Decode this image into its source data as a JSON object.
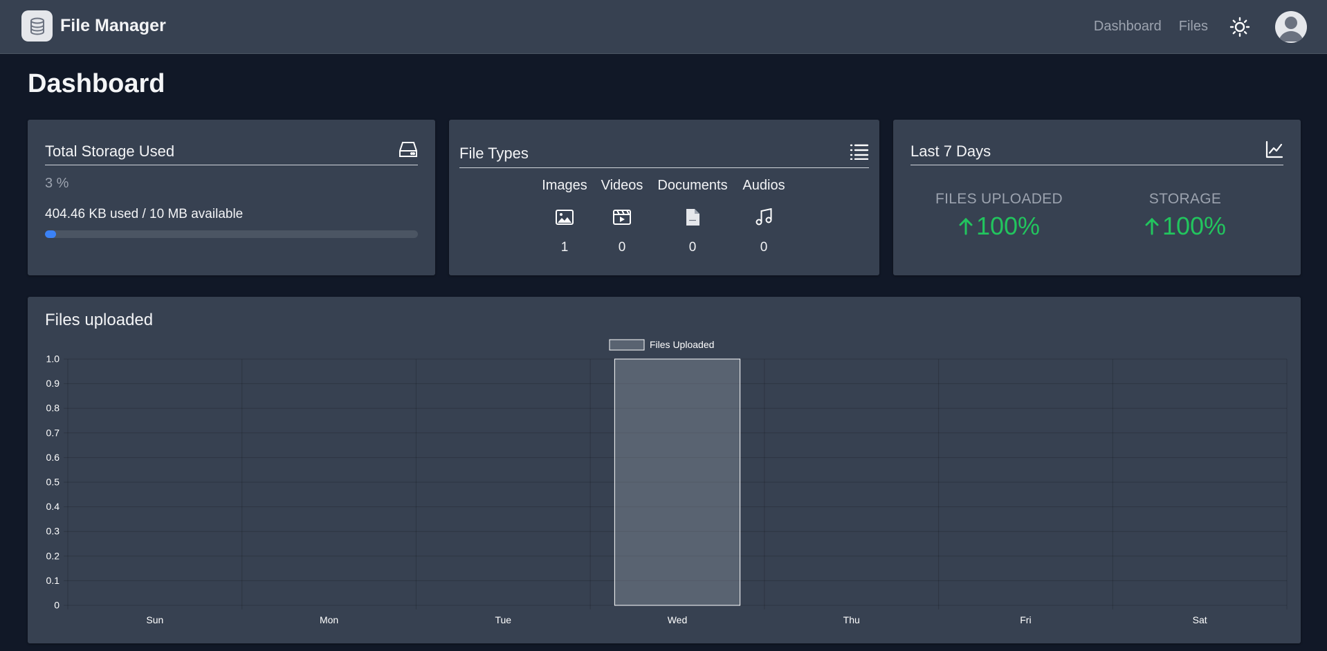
{
  "app": {
    "title": "File Manager"
  },
  "nav": {
    "links": [
      "Dashboard",
      "Files"
    ]
  },
  "page": {
    "title": "Dashboard"
  },
  "storage": {
    "title": "Total Storage Used",
    "percent_text": "3 %",
    "detail": "404.46 KB used / 10 MB available",
    "progress_fraction": 0.03
  },
  "file_types": {
    "title": "File Types",
    "items": [
      {
        "label": "Images",
        "count": "1",
        "icon": "image-icon"
      },
      {
        "label": "Videos",
        "count": "0",
        "icon": "video-icon"
      },
      {
        "label": "Documents",
        "count": "0",
        "icon": "document-icon"
      },
      {
        "label": "Audios",
        "count": "0",
        "icon": "audio-icon"
      }
    ]
  },
  "last7": {
    "title": "Last 7 Days",
    "stats": [
      {
        "label": "FILES UPLOADED",
        "value": "100%"
      },
      {
        "label": "STORAGE",
        "value": "100%"
      }
    ]
  },
  "colors": {
    "background": "#111827",
    "card": "#374151",
    "accent_green": "#22c55e",
    "progress_blue": "#3b82f6"
  },
  "chart_data": {
    "type": "bar",
    "title": "Files uploaded",
    "categories": [
      "Sun",
      "Mon",
      "Tue",
      "Wed",
      "Thu",
      "Fri",
      "Sat"
    ],
    "series": [
      {
        "name": "Files Uploaded",
        "values": [
          0,
          0,
          0,
          1,
          0,
          0,
          0
        ]
      }
    ],
    "ylim": [
      0,
      1
    ],
    "yticks": [
      "0",
      "0.1",
      "0.2",
      "0.3",
      "0.4",
      "0.5",
      "0.6",
      "0.7",
      "0.8",
      "0.9",
      "1.0"
    ],
    "grid": true,
    "legend": "top"
  }
}
